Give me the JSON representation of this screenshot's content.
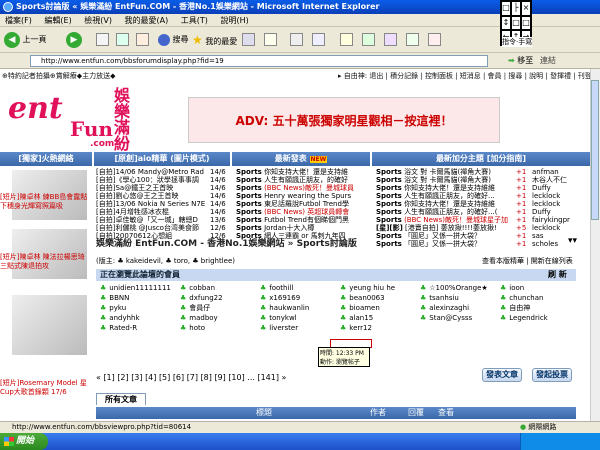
{
  "window": {
    "title": "Sports討論版 « 娛樂滿紛 EntFun.COM - 香港No.1娛樂網站 - Microsoft Internet Explorer"
  },
  "menu": [
    "檔案(F)",
    "編輯(E)",
    "檢視(V)",
    "我的最愛(A)",
    "工具(T)",
    "說明(H)"
  ],
  "toolbar": {
    "back": "上一頁",
    "search": "搜尋",
    "favorites": "我的最愛"
  },
  "address": {
    "url": "http://www.entfun.com/bbsforumdisplay.php?fid=19",
    "go": "移至",
    "links": "連結"
  },
  "panel": {
    "keys": [
      "□",
      "├",
      "×",
      "↕",
      "□",
      "□",
      "←",
      "↑",
      "→"
    ],
    "label": "指令·手寫"
  },
  "status": {
    "url": "http://www.entfun.com/bbsviewpro.php?tid=80614",
    "zone": "網際網路"
  },
  "taskbar": {
    "start": "開始"
  },
  "site": {
    "notice": "⊕特約記者拍攝⊕賞解療◆主力放送◆",
    "user_bar": "▸ 自由神: 退出 | 積分記錄 | 控制面板 | 短消息 | 會員 | 搜尋 | 說明 | 發揮禮 | 刊登廣告",
    "logo_ent": "ent",
    "logo_fun": "Fun",
    "logo_com": ".com",
    "logo_cn": "娛樂滿紛",
    "ad": "ADV: 五十萬張獨家明星觀相－按這裡！"
  },
  "headers": {
    "hot": "[獨家]火熱網絡",
    "lovely": "[原創]aio精華",
    "lovely_tag": "(圖片模式)",
    "latest": "最新發表",
    "latest_badge": "NEW",
    "points": "最新加分主題",
    "points_tag": "[加分指南]"
  },
  "hot_captions": [
    "[短片]陳卓林 練BB島會露點下穗身光輝寫照篇吸",
    "[短片]陳卓林 陳法拉楊思琦 三點式陳退拍攻",
    "[短片]Rosemary Model 星Cup大歌首錄顆 17/6"
  ],
  "lovely_list": [
    [
      "[自拍]14/06 Mandy@Metro Rad",
      "14/6"
    ],
    [
      "[自拍]《學心100：狀學拯事事調",
      "14/6"
    ],
    [
      "[自拍]Sa@鐵王之王首映",
      "14/6"
    ],
    [
      "[自拍]劉心悠@王之王首映",
      "14/6"
    ],
    [
      "[自拍]13/06 Nokia N Series N7E",
      "14/6"
    ],
    [
      "[自拍]4月增牲感冰衣棍",
      "14/6"
    ],
    [
      "[自拍]卓佳敏@「又一城」轄總D",
      "13/6"
    ],
    [
      "[自拍]利儷桃 @Jusco台湾美食節",
      "12/6"
    ],
    [
      "[自拍]20070612心想組",
      "12/6"
    ]
  ],
  "latest_list": [
    [
      "Sports",
      "你知支持大佬！還是支持維"
    ],
    [
      "Sports",
      "人生有願諷正朋友，的確好"
    ],
    [
      "Sports",
      "(BBC News)敵死！曼城球員"
    ],
    [
      "Sports",
      "Henry wearing the Spurs"
    ],
    [
      "Sports",
      "東尼話羅說Futbol Trend學"
    ],
    [
      "Sports",
      "(BBC News) 英超球員轉會"
    ],
    [
      "Sports",
      "Futbol Trend有個睇個門黑"
    ],
    [
      "Sports",
      "Jordan十大入樽"
    ],
    [
      "Sports",
      "網人三連霸 or 馬刺九年四"
    ]
  ],
  "points_list": [
    [
      "Sports",
      "浴文 對 卡爾馬貓(禪角大賽)",
      "+1",
      "anfman"
    ],
    [
      "Sports",
      "浴文 對 卡爾馬貓(禪角大賽)",
      "+1",
      "木谷人不仁"
    ],
    [
      "Sports",
      "你知支持大佬！還是支持維維",
      "+1",
      "Duffy"
    ],
    [
      "Sports",
      "人生有願諷正朋友，的確好...",
      "+1",
      "lecklock"
    ],
    [
      "Sports",
      "你知支持大佬！還是支持維維",
      "+1",
      "lecklock"
    ],
    [
      "Sports",
      "人生有願諷正朋友，的確好...(",
      "+1",
      "Duffy"
    ],
    [
      "Sports",
      "(BBC News)敵死！曼城球星子加",
      "+1",
      "fairykingpr"
    ],
    [
      "[星][影]",
      "[港賣自拍] 萎放揪!!!!萎放揪!",
      "+5",
      "lecklock"
    ],
    [
      "Sports",
      "「圓尼」又係一拼大袋？",
      "+1",
      "sas"
    ],
    [
      "Sports",
      "「圓尼」又係一拼大袋？",
      "+1",
      "scholes"
    ]
  ],
  "forum": {
    "breadcrumb": "娛樂滿紛 EntFun.COM - 香港No.1娛樂網站 » Sports討論版",
    "moderators": "(版主: ♣ kakeidevil, ♣ toro, ♣ brightlee)",
    "mods_right": "查看本版精華 | 開新在線列表",
    "browsing_title": "正在瀏覽此論壇的會員",
    "refresh": "刷  新",
    "users": [
      "unidien11111111",
      "cobban",
      "foothill",
      "yeung hiu he",
      "☆100%Orange★",
      "ioon",
      "BBNN",
      "dxfung22",
      "x169169",
      "bean0063",
      "tsanhsiu",
      "chunchan",
      "pyku",
      "會員仔",
      "haukwanlin",
      "bioamen",
      "alexinzaghi",
      "自由神",
      "andyhhk",
      "madboy",
      "tonykwl",
      "alan15",
      "Stan@Cysss",
      "Legendrick",
      "Rated-R",
      "hoto",
      "liverster",
      "kerr12"
    ],
    "tooltip_time": "時間: 12:33 PM",
    "tooltip_action": "動作: 瀏覽帖子",
    "pager": "« [1] [2] [3] [4] [5] [6] [7] [8] [9] [10] ... [141] »",
    "btn_post": "發表文章",
    "btn_poll": "發起投票",
    "tab_all": "所有文章",
    "col_title": "標題",
    "col_author": "作者",
    "col_replies": "回覆",
    "col_views": "查看"
  }
}
